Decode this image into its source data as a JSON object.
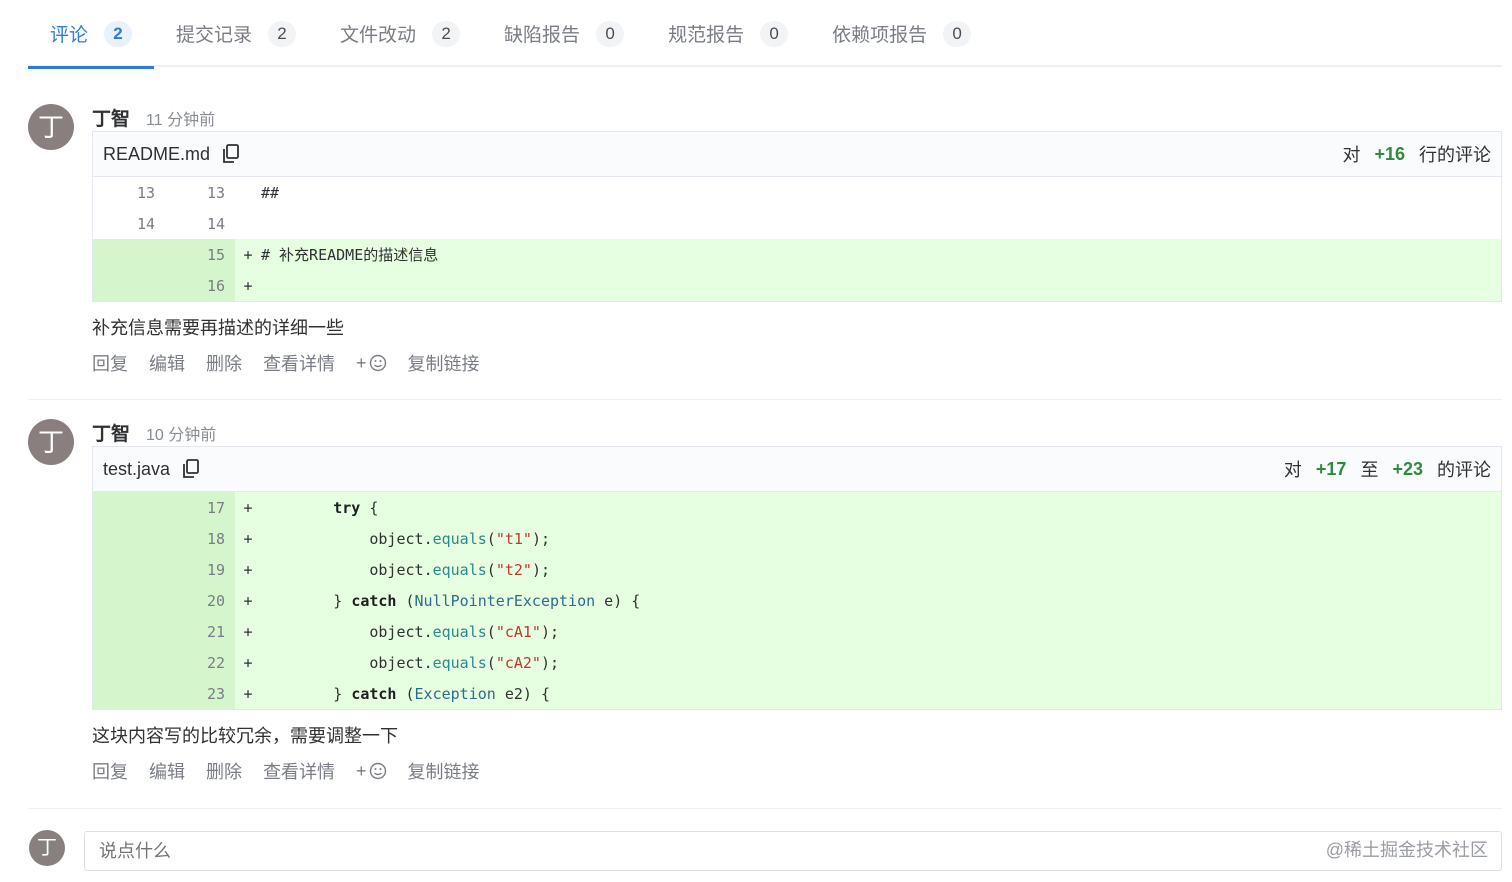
{
  "tabs": [
    {
      "label": "评论",
      "count": "2"
    },
    {
      "label": "提交记录",
      "count": "2"
    },
    {
      "label": "文件改动",
      "count": "2"
    },
    {
      "label": "缺陷报告",
      "count": "0"
    },
    {
      "label": "规范报告",
      "count": "0"
    },
    {
      "label": "依赖项报告",
      "count": "0"
    }
  ],
  "comments": [
    {
      "avatar": "丁",
      "author": "丁智",
      "time": "11 分钟前",
      "file": "README.md",
      "range_prefix": "对",
      "range_start": "+16",
      "range_suffix": "行的评论",
      "text": "补充信息需要再描述的详细一些"
    },
    {
      "avatar": "丁",
      "author": "丁智",
      "time": "10 分钟前",
      "file": "test.java",
      "range_prefix": "对",
      "range_start": "+17",
      "range_mid": "至",
      "range_end": "+23",
      "range_suffix": "的评论",
      "text": "这块内容写的比较冗余，需要调整一下"
    }
  ],
  "actions": {
    "reply": "回复",
    "edit": "编辑",
    "delete": "删除",
    "details": "查看详情",
    "emoji_plus": "+",
    "copy_link": "复制链接"
  },
  "diff1": [
    {
      "old": "13",
      "new": "13",
      "sign": "",
      "code": "##"
    },
    {
      "old": "14",
      "new": "14",
      "sign": "",
      "code": ""
    },
    {
      "old": "",
      "new": "15",
      "sign": "+",
      "code": "# 补充README的描述信息"
    },
    {
      "old": "",
      "new": "16",
      "sign": "+",
      "code": ""
    }
  ],
  "diff2_numbers": [
    "17",
    "18",
    "19",
    "20",
    "21",
    "22",
    "23"
  ],
  "diff2_sign": "+",
  "code2": {
    "l17_kw": "try",
    "l17_rest": " {",
    "obj": "object",
    "dot": ".",
    "equals": "equals",
    "t1": "\"t1\"",
    "t2": "\"t2\"",
    "cA1": "\"cA1\"",
    "cA2": "\"cA2\"",
    "open": "(",
    "close": ");",
    "brace_close": "} ",
    "catch": "catch",
    "npe": "NullPointerException",
    "npe_rest": " e) {",
    "exc": "Exception",
    "exc_rest": " e2) {",
    "paren": " ("
  },
  "reply": {
    "avatar": "丁",
    "placeholder": "说点什么"
  },
  "watermark": "@稀土掘金技术社区"
}
